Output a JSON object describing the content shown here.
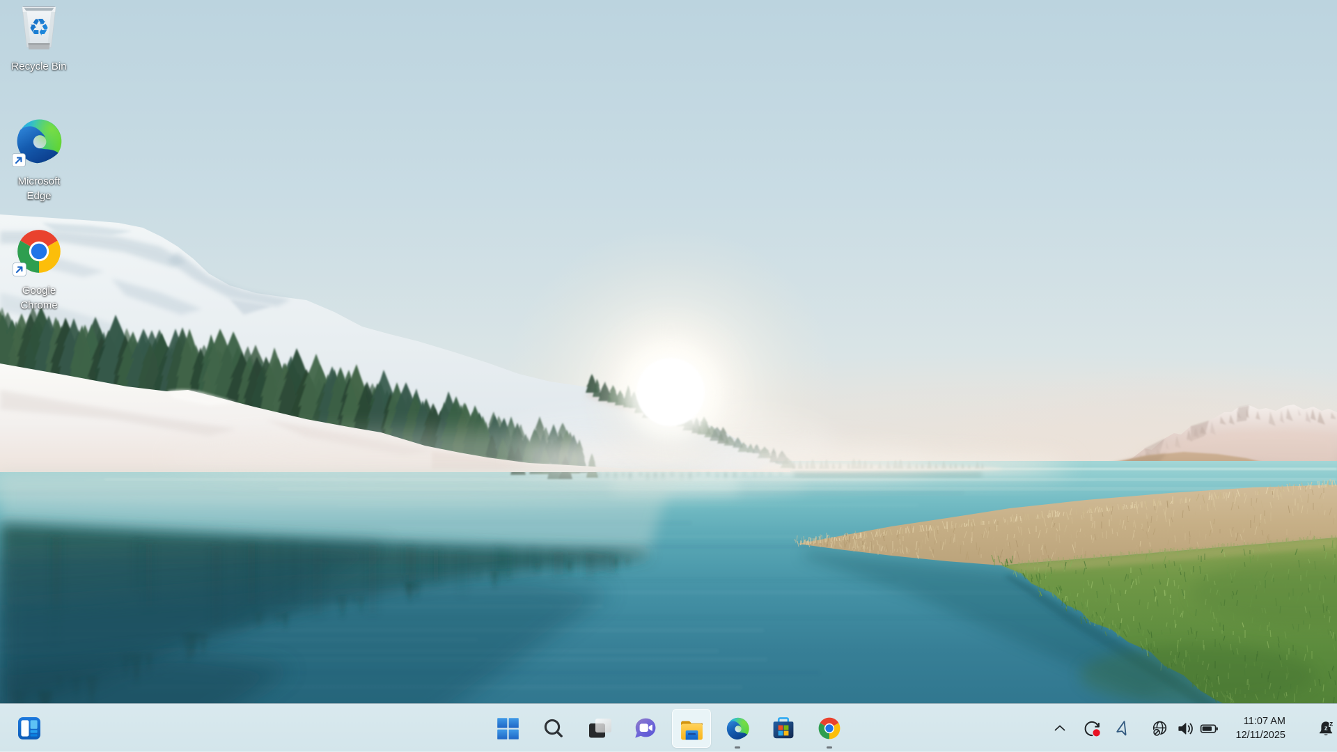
{
  "desktop": {
    "icons": [
      {
        "name": "recycle-bin",
        "label": "Recycle Bin"
      },
      {
        "name": "microsoft-edge",
        "label": "Microsoft Edge"
      },
      {
        "name": "google-chrome",
        "label": "Google Chrome"
      }
    ]
  },
  "taskbar": {
    "buttons": [
      {
        "name": "widgets"
      },
      {
        "name": "start"
      },
      {
        "name": "search"
      },
      {
        "name": "task-view"
      },
      {
        "name": "chat"
      },
      {
        "name": "file-explorer",
        "highlighted": true
      },
      {
        "name": "microsoft-edge",
        "running": true
      },
      {
        "name": "microsoft-store"
      },
      {
        "name": "google-chrome",
        "running": true
      }
    ],
    "tray": {
      "time": "11:07 AM",
      "date": "12/11/2025"
    }
  },
  "colors": {
    "taskbar_bg": "#d5e7ec",
    "accent_blue": "#2e7fd6",
    "sky_top": "#c2d8e1",
    "water_deep": "#22667e"
  }
}
